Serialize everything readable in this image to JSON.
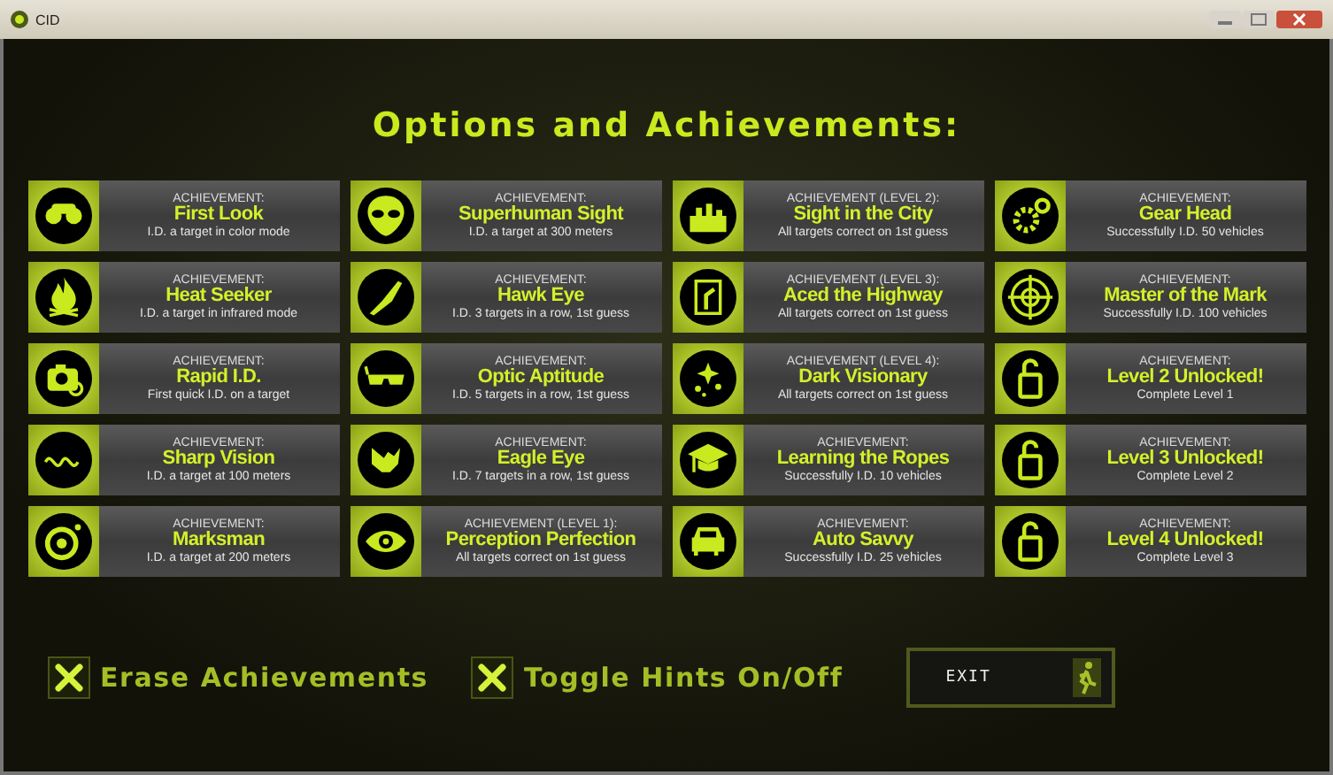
{
  "window": {
    "title": "CID"
  },
  "heading": "Options and Achievements:",
  "achievements": [
    {
      "header": "ACHIEVEMENT:",
      "name": "First Look",
      "desc": "I.D. a target in color mode"
    },
    {
      "header": "ACHIEVEMENT:",
      "name": "Superhuman Sight",
      "desc": "I.D. a target at 300 meters"
    },
    {
      "header": "ACHIEVEMENT (LEVEL 2):",
      "name": "Sight in the City",
      "desc": "All targets correct on 1st guess"
    },
    {
      "header": "ACHIEVEMENT:",
      "name": "Gear Head",
      "desc": "Successfully I.D. 50 vehicles"
    },
    {
      "header": "ACHIEVEMENT:",
      "name": "Heat Seeker",
      "desc": "I.D. a target in infrared mode"
    },
    {
      "header": "ACHIEVEMENT:",
      "name": "Hawk Eye",
      "desc": "I.D. 3 targets in a row, 1st guess"
    },
    {
      "header": "ACHIEVEMENT (LEVEL 3):",
      "name": "Aced the Highway",
      "desc": "All targets correct on 1st guess"
    },
    {
      "header": "ACHIEVEMENT:",
      "name": "Master of the Mark",
      "desc": "Successfully I.D. 100 vehicles"
    },
    {
      "header": "ACHIEVEMENT:",
      "name": "Rapid I.D.",
      "desc": "First quick I.D. on a target"
    },
    {
      "header": "ACHIEVEMENT:",
      "name": "Optic Aptitude",
      "desc": "I.D. 5 targets in a row, 1st guess"
    },
    {
      "header": "ACHIEVEMENT (LEVEL 4):",
      "name": "Dark Visionary",
      "desc": "All targets correct on 1st guess"
    },
    {
      "header": "ACHIEVEMENT:",
      "name": "Level 2 Unlocked!",
      "desc": "Complete Level 1"
    },
    {
      "header": "ACHIEVEMENT:",
      "name": "Sharp Vision",
      "desc": "I.D. a target at 100 meters"
    },
    {
      "header": "ACHIEVEMENT:",
      "name": "Eagle Eye",
      "desc": "I.D. 7 targets in a row, 1st guess"
    },
    {
      "header": "ACHIEVEMENT:",
      "name": "Learning the Ropes",
      "desc": "Successfully I.D. 10 vehicles"
    },
    {
      "header": "ACHIEVEMENT:",
      "name": "Level 3 Unlocked!",
      "desc": "Complete Level 2"
    },
    {
      "header": "ACHIEVEMENT:",
      "name": "Marksman",
      "desc": "I.D. a target at 200 meters"
    },
    {
      "header": "ACHIEVEMENT (LEVEL 1):",
      "name": "Perception Perfection",
      "desc": "All targets correct on 1st guess"
    },
    {
      "header": "ACHIEVEMENT:",
      "name": "Auto Savvy",
      "desc": "Successfully I.D. 25 vehicles"
    },
    {
      "header": "ACHIEVEMENT:",
      "name": "Level 4 Unlocked!",
      "desc": "Complete Level 3"
    }
  ],
  "buttons": [
    {
      "label": "Erase Achievements"
    },
    {
      "label": "Toggle Hints On/Off"
    }
  ],
  "exit": {
    "label": "EXIT"
  }
}
